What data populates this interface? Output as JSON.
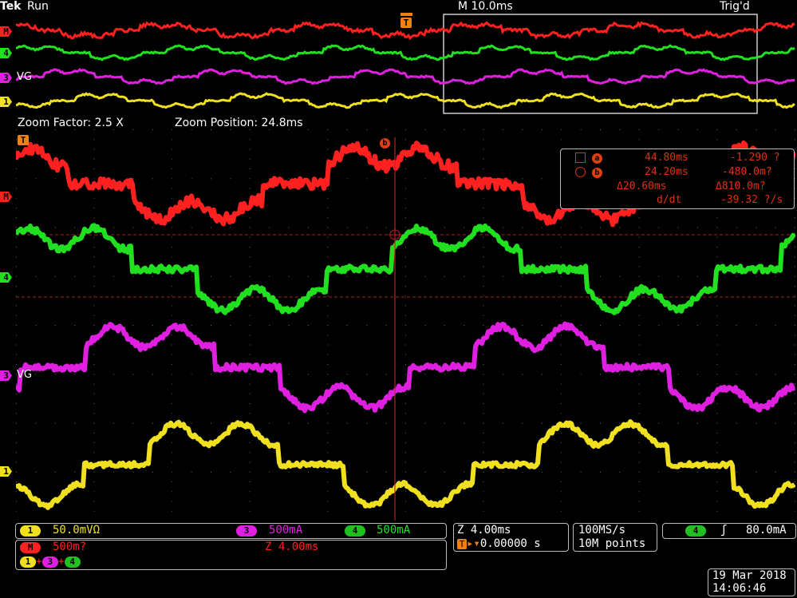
{
  "header": {
    "brand": "Tek",
    "state": "Run",
    "timebase": "M 10.0ms",
    "trigger_status": "Trig'd"
  },
  "zoom_bar": {
    "factor": "Zoom Factor: 2.5 X",
    "position": "Zoom Position: 24.8ms"
  },
  "channels": {
    "m": {
      "mark": "M",
      "color": "#ff2020"
    },
    "ch4": {
      "mark": "4",
      "color": "#20e020"
    },
    "ch3": {
      "mark": "3",
      "color": "#e020e0",
      "label": "VG"
    },
    "ch1": {
      "mark": "1",
      "color": "#f0e020"
    }
  },
  "markers": {
    "trigger": "T",
    "cursor_b": "b"
  },
  "cursor_readout": {
    "a_label": "a",
    "b_label": "b",
    "a_time": "44.80ms",
    "a_value": "-1.290 ?",
    "b_time": "24.20ms",
    "b_value": "-480.0m?",
    "delta_time": "Δ20.60ms",
    "delta_value": "Δ810.0m?",
    "ddt_label": "d/dt",
    "ddt_value": "-39.32 ?/s"
  },
  "bottom": {
    "ch1_badge": "1",
    "ch1_scale": "50.0mVΩ",
    "ch3_badge": "3",
    "ch3_scale": "500mA",
    "ch4_badge": "4",
    "ch4_scale": "500mA",
    "math_badge": "M",
    "math_scale": "500m?",
    "math_zoom": "Z 4.00ms",
    "math_expr_1": "1",
    "math_expr_plus1": "+",
    "math_expr_3": "3",
    "math_expr_plus2": "+",
    "math_expr_4": "4",
    "zoom_scale": "Z 4.00ms",
    "trigger_pos": "T▸▾0.00000 s",
    "sample_rate": "100MS/s",
    "record_length": "10M points",
    "trig_badge": "4",
    "trig_slope": "↗",
    "trig_level": "80.0mA",
    "date": "19 Mar  2018",
    "time": "14:06:46"
  }
}
